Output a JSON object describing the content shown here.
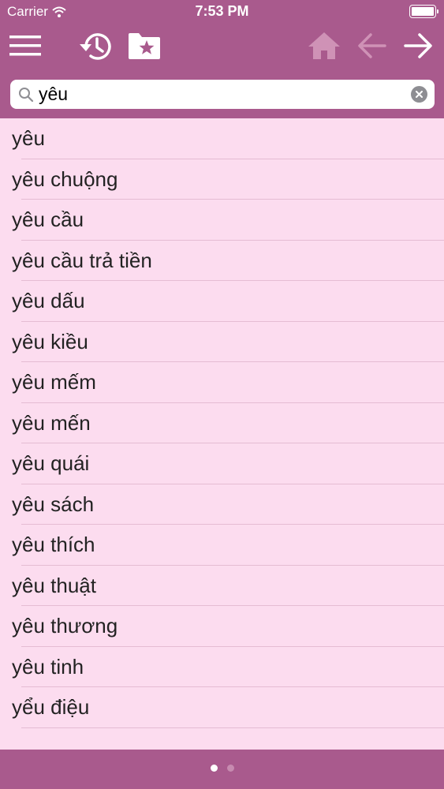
{
  "status_bar": {
    "carrier": "Carrier",
    "time": "7:53 PM"
  },
  "toolbar": {
    "icons": [
      "menu-icon",
      "history-icon",
      "favorites-folder-icon",
      "home-icon",
      "back-arrow-icon",
      "forward-arrow-icon"
    ],
    "disabled": [
      "home-icon",
      "back-arrow-icon"
    ]
  },
  "search": {
    "value": "yêu"
  },
  "results": [
    "yêu",
    "yêu chuộng",
    "yêu cầu",
    "yêu cầu trả tiền",
    "yêu dấu",
    "yêu kiều",
    "yêu mếm",
    "yêu mến",
    "yêu quái",
    "yêu sách",
    "yêu thích",
    "yêu thuật",
    "yêu thương",
    "yêu tinh",
    "yểu điệu"
  ],
  "pager": {
    "pages": 2,
    "current": 1
  },
  "colors": {
    "bar": "#a95a8d",
    "list_background": "#fcdcef",
    "separator": "#e5bcd3"
  }
}
